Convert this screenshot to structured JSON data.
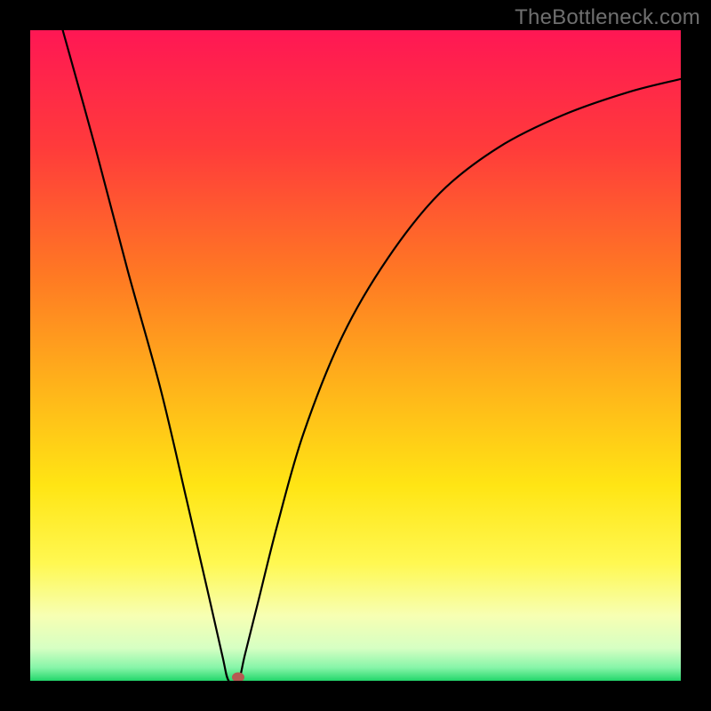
{
  "watermark": "TheBottleneck.com",
  "colors": {
    "frame": "#000000",
    "curve": "#000000",
    "marker": "#b65a52",
    "gradient_stops": [
      {
        "pct": 0,
        "color": "#ff1754"
      },
      {
        "pct": 18,
        "color": "#ff3b3b"
      },
      {
        "pct": 38,
        "color": "#ff7a23"
      },
      {
        "pct": 55,
        "color": "#ffb41a"
      },
      {
        "pct": 70,
        "color": "#ffe514"
      },
      {
        "pct": 82,
        "color": "#fff852"
      },
      {
        "pct": 90,
        "color": "#f7ffb3"
      },
      {
        "pct": 95,
        "color": "#d6ffc3"
      },
      {
        "pct": 98,
        "color": "#86f5a8"
      },
      {
        "pct": 100,
        "color": "#23d66b"
      }
    ]
  },
  "chart_data": {
    "type": "line",
    "title": "",
    "xlabel": "",
    "ylabel": "",
    "xlim": [
      0,
      100
    ],
    "ylim": [
      0,
      100
    ],
    "grid": false,
    "legend": false,
    "series": [
      {
        "name": "curve",
        "x": [
          5,
          10,
          15,
          20,
          24,
          27,
          29.5,
          30.5,
          32,
          33,
          35,
          38,
          42,
          48,
          55,
          63,
          72,
          82,
          92,
          100
        ],
        "y": [
          100,
          82,
          63,
          45,
          28,
          15,
          4,
          0,
          0,
          4,
          12,
          24,
          38,
          53,
          65,
          75,
          82,
          87,
          90.5,
          92.5
        ]
      }
    ],
    "markers": [
      {
        "name": "min-point",
        "x": 32,
        "y": 0.5
      }
    ]
  }
}
